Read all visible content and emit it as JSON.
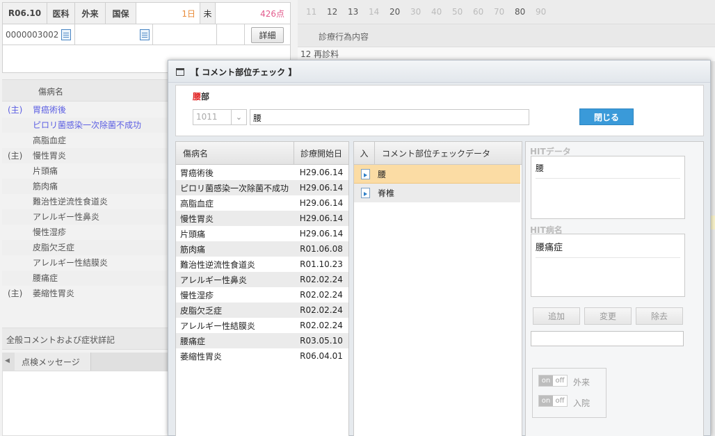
{
  "header": {
    "date": "R06.10",
    "dept": "医科",
    "visit": "外来",
    "insurance": "国保",
    "days": "1日",
    "status": "未",
    "points": "426点",
    "patient_id": "0000003002",
    "detail_button": "詳細"
  },
  "left": {
    "disease_header": "傷病名",
    "diseases": [
      {
        "main": "(主)",
        "name": "胃癌術後",
        "link": true
      },
      {
        "main": "",
        "name": "ピロリ菌感染一次除菌不成功",
        "link": true
      },
      {
        "main": "",
        "name": "高脂血症",
        "link": false
      },
      {
        "main": "(主)",
        "name": "慢性胃炎",
        "link": false
      },
      {
        "main": "",
        "name": "片頭痛",
        "link": false
      },
      {
        "main": "",
        "name": "筋肉痛",
        "link": false
      },
      {
        "main": "",
        "name": "難治性逆流性食道炎",
        "link": false
      },
      {
        "main": "",
        "name": "アレルギー性鼻炎",
        "link": false
      },
      {
        "main": "",
        "name": "慢性湿疹",
        "link": false
      },
      {
        "main": "",
        "name": "皮脂欠乏症",
        "link": false
      },
      {
        "main": "",
        "name": "アレルギー性結膜炎",
        "link": false
      },
      {
        "main": "",
        "name": "腰痛症",
        "link": false
      },
      {
        "main": "(主)",
        "name": "萎縮性胃炎",
        "link": false
      }
    ],
    "general_comment": "全般コメントおよび症状詳記",
    "check_message_tab": "点検メッセージ"
  },
  "right_bg": {
    "day_numbers": [
      "11",
      "12",
      "13",
      "14",
      "20",
      "30",
      "40",
      "50",
      "60",
      "70",
      "80",
      "90"
    ],
    "active_days": [
      "12",
      "13",
      "20",
      "80"
    ],
    "column_header": "診療行為内容",
    "first_row": "12 再診料"
  },
  "dialog": {
    "title": "【 コメント部位チェック 】",
    "part_label_red": "腰",
    "part_label_rest": "部",
    "code_value": "1011",
    "part_value": "腰",
    "close_button": "閉じる",
    "disease_table": {
      "col_name": "傷病名",
      "col_date": "診療開始日",
      "rows": [
        {
          "name": "胃癌術後",
          "date": "H29.06.14"
        },
        {
          "name": "ピロリ菌感染一次除菌不成功",
          "date": "H29.06.14"
        },
        {
          "name": "高脂血症",
          "date": "H29.06.14"
        },
        {
          "name": "慢性胃炎",
          "date": "H29.06.14"
        },
        {
          "name": "片頭痛",
          "date": "H29.06.14"
        },
        {
          "name": "筋肉痛",
          "date": "R01.06.08"
        },
        {
          "name": "難治性逆流性食道炎",
          "date": "R01.10.23"
        },
        {
          "name": "アレルギー性鼻炎",
          "date": "R02.02.24"
        },
        {
          "name": "慢性湿疹",
          "date": "R02.02.24"
        },
        {
          "name": "皮脂欠乏症",
          "date": "R02.02.24"
        },
        {
          "name": "アレルギー性結膜炎",
          "date": "R02.02.24"
        },
        {
          "name": "腰痛症",
          "date": "R03.05.10"
        },
        {
          "name": "萎縮性胃炎",
          "date": "R06.04.01"
        }
      ]
    },
    "check_table": {
      "col_in": "入",
      "col_data": "コメント部位チェックデータ",
      "rows": [
        {
          "label": "腰",
          "selected": true
        },
        {
          "label": "脊椎",
          "selected": false
        }
      ]
    },
    "hit_data_label": "HITデータ",
    "hit_data_value": "腰",
    "hit_disease_label": "HIT病名",
    "hit_disease_value": "腰痛症",
    "add_button": "追加",
    "change_button": "変更",
    "remove_button": "除去",
    "toggle_on": "on",
    "toggle_off": "off",
    "outpatient_label": "外来",
    "inpatient_label": "入院"
  }
}
